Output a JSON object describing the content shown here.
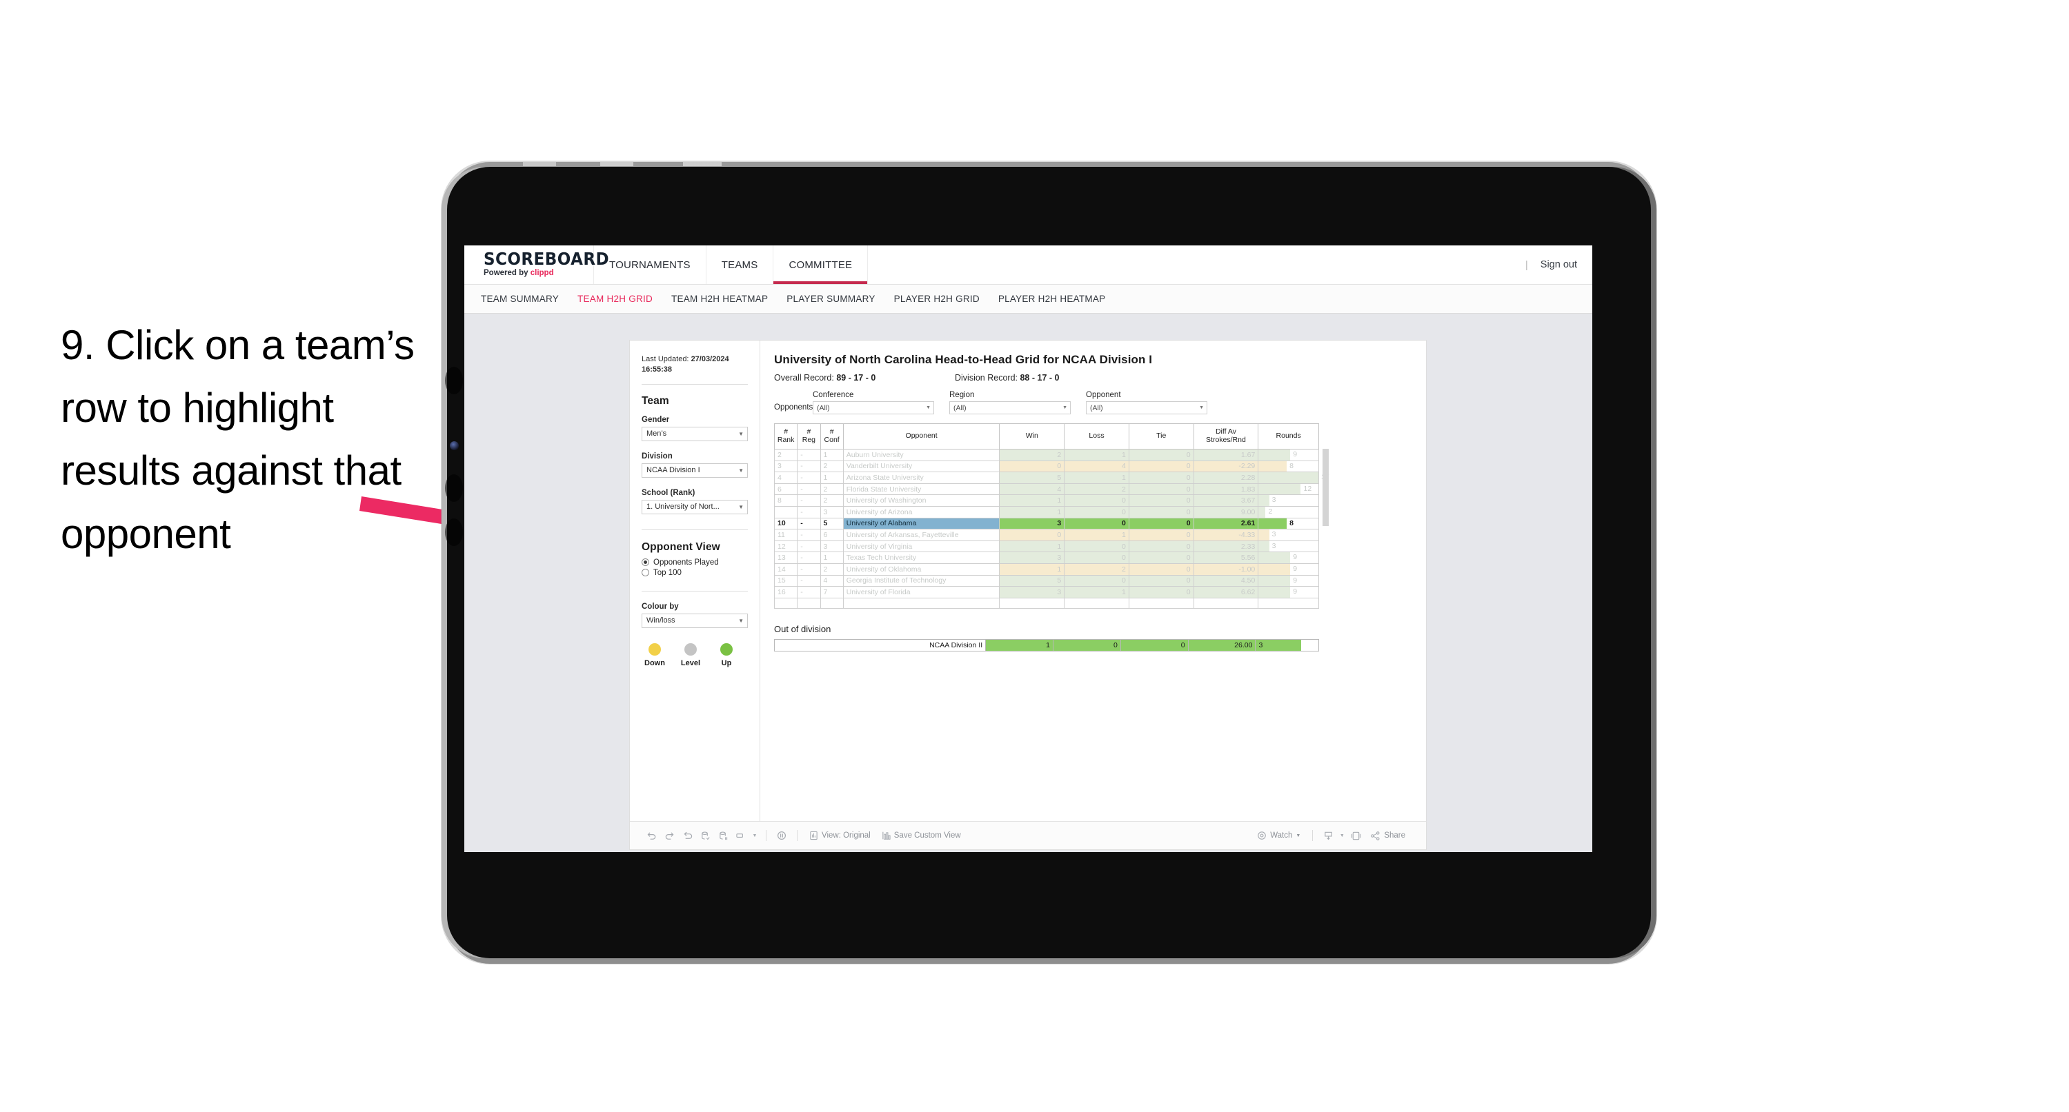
{
  "instruction": {
    "text": "9. Click on a team’s row to highlight results against that opponent"
  },
  "colors": {
    "accent_pink": "#e8295b",
    "arrow_pink": "#ec2a63",
    "highlight_row_name": "#82b2d0",
    "highlight_row_green": "#8bce63",
    "win_tint": "#e3ecdd",
    "loss_tint": "#f7ebcf",
    "legend_down": "#f2d048",
    "legend_level": "#c4c4c4",
    "legend_up": "#7ac143"
  },
  "topbar": {
    "brand_title": "SCOREBOARD",
    "brand_sub_prefix": "Powered by ",
    "brand_sub_accent": "clippd",
    "nav": [
      {
        "label": "TOURNAMENTS",
        "active": false
      },
      {
        "label": "TEAMS",
        "active": false
      },
      {
        "label": "COMMITTEE",
        "active": true
      }
    ],
    "divider": "|",
    "signout": "Sign out"
  },
  "subnav": {
    "items": [
      {
        "label": "TEAM SUMMARY",
        "active": false
      },
      {
        "label": "TEAM H2H GRID",
        "active": true
      },
      {
        "label": "TEAM H2H HEATMAP",
        "active": false
      },
      {
        "label": "PLAYER SUMMARY",
        "active": false
      },
      {
        "label": "PLAYER H2H GRID",
        "active": false
      },
      {
        "label": "PLAYER H2H HEATMAP",
        "active": false
      }
    ]
  },
  "sidebar": {
    "last_updated_label": "Last Updated: ",
    "last_updated_value": "27/03/2024 16:55:38",
    "team_heading": "Team",
    "gender_label": "Gender",
    "gender_value": "Men’s",
    "division_label": "Division",
    "division_value": "NCAA Division I",
    "school_label": "School (Rank)",
    "school_value": "1. University of Nort...",
    "opponent_view_heading": "Opponent View",
    "opponent_view_options": [
      {
        "label": "Opponents Played",
        "selected": true
      },
      {
        "label": "Top 100",
        "selected": false
      }
    ],
    "colour_by_label": "Colour by",
    "colour_by_value": "Win/loss",
    "legend": [
      {
        "caption": "Down",
        "color": "#f2d048"
      },
      {
        "caption": "Level",
        "color": "#c4c4c4"
      },
      {
        "caption": "Up",
        "color": "#7ac143"
      }
    ]
  },
  "view": {
    "title": "University of North Carolina Head-to-Head Grid for NCAA Division I",
    "overall_record_label": "Overall Record: ",
    "overall_record_value": "89 - 17 - 0",
    "division_record_label": "Division Record: ",
    "division_record_value": "88 - 17 - 0",
    "opponents_label": "Opponents:",
    "filters": [
      {
        "caption": "Conference",
        "value": "(All)"
      },
      {
        "caption": "Region",
        "value": "(All)"
      },
      {
        "caption": "Opponent",
        "value": "(All)"
      }
    ]
  },
  "grid": {
    "headers": [
      "# Rank",
      "# Reg",
      "# Conf",
      "Opponent",
      "Win",
      "Loss",
      "Tie",
      "Diff Av Strokes/Rnd",
      "Rounds"
    ],
    "headers_split": [
      {
        "l1": "#",
        "l2": "Rank"
      },
      {
        "l1": "#",
        "l2": "Reg"
      },
      {
        "l1": "#",
        "l2": "Conf"
      },
      {
        "l1": "",
        "l2": "Opponent"
      },
      {
        "l1": "Win",
        "l2": ""
      },
      {
        "l1": "Loss",
        "l2": ""
      },
      {
        "l1": "Tie",
        "l2": ""
      },
      {
        "l1": "Diff Av",
        "l2": "Strokes/Rnd"
      },
      {
        "l1": "Rounds",
        "l2": ""
      }
    ],
    "rounds_max": 17,
    "rows": [
      {
        "rank": "2",
        "reg": "-",
        "conf": "1",
        "opponent": "Auburn University",
        "win": "2",
        "loss": "1",
        "tie": "0",
        "diff": "1.67",
        "rounds": "9",
        "state": "win",
        "highlighted": false
      },
      {
        "rank": "3",
        "reg": "-",
        "conf": "2",
        "opponent": "Vanderbilt University",
        "win": "0",
        "loss": "4",
        "tie": "0",
        "diff": "-2.29",
        "rounds": "8",
        "state": "loss",
        "highlighted": false
      },
      {
        "rank": "4",
        "reg": "-",
        "conf": "1",
        "opponent": "Arizona State University",
        "win": "5",
        "loss": "1",
        "tie": "0",
        "diff": "2.28",
        "rounds": "17",
        "state": "win",
        "highlighted": false
      },
      {
        "rank": "6",
        "reg": "-",
        "conf": "2",
        "opponent": "Florida State University",
        "win": "4",
        "loss": "2",
        "tie": "0",
        "diff": "1.83",
        "rounds": "12",
        "state": "win",
        "highlighted": false
      },
      {
        "rank": "8",
        "reg": "-",
        "conf": "2",
        "opponent": "University of Washington",
        "win": "1",
        "loss": "0",
        "tie": "0",
        "diff": "3.67",
        "rounds": "3",
        "state": "win",
        "highlighted": false
      },
      {
        "rank": "",
        "reg": "-",
        "conf": "3",
        "opponent": "University of Arizona",
        "win": "1",
        "loss": "0",
        "tie": "0",
        "diff": "9.00",
        "rounds": "2",
        "state": "win",
        "highlighted": false
      },
      {
        "rank": "10",
        "reg": "-",
        "conf": "5",
        "opponent": "University of Alabama",
        "win": "3",
        "loss": "0",
        "tie": "0",
        "diff": "2.61",
        "rounds": "8",
        "state": "win",
        "highlighted": true
      },
      {
        "rank": "11",
        "reg": "-",
        "conf": "6",
        "opponent": "University of Arkansas, Fayetteville",
        "win": "0",
        "loss": "1",
        "tie": "0",
        "diff": "-4.33",
        "rounds": "3",
        "state": "loss",
        "highlighted": false
      },
      {
        "rank": "12",
        "reg": "-",
        "conf": "3",
        "opponent": "University of Virginia",
        "win": "1",
        "loss": "0",
        "tie": "0",
        "diff": "2.33",
        "rounds": "3",
        "state": "win",
        "highlighted": false
      },
      {
        "rank": "13",
        "reg": "-",
        "conf": "1",
        "opponent": "Texas Tech University",
        "win": "3",
        "loss": "0",
        "tie": "0",
        "diff": "5.56",
        "rounds": "9",
        "state": "win",
        "highlighted": false
      },
      {
        "rank": "14",
        "reg": "-",
        "conf": "2",
        "opponent": "University of Oklahoma",
        "win": "1",
        "loss": "2",
        "tie": "0",
        "diff": "-1.00",
        "rounds": "9",
        "state": "loss",
        "highlighted": false
      },
      {
        "rank": "15",
        "reg": "-",
        "conf": "4",
        "opponent": "Georgia Institute of Technology",
        "win": "5",
        "loss": "0",
        "tie": "0",
        "diff": "4.50",
        "rounds": "9",
        "state": "win",
        "highlighted": false
      },
      {
        "rank": "16",
        "reg": "-",
        "conf": "7",
        "opponent": "University of Florida",
        "win": "3",
        "loss": "1",
        "tie": "0",
        "diff": "6.62",
        "rounds": "9",
        "state": "win",
        "highlighted": false
      }
    ]
  },
  "out_of_division": {
    "title": "Out of division",
    "row": {
      "name": "NCAA Division II",
      "win": "1",
      "loss": "0",
      "tie": "0",
      "diff": "26.00",
      "rounds": "3"
    }
  },
  "toolbar": {
    "view_label": "View: Original",
    "save_label": "Save Custom View",
    "watch_label": "Watch",
    "share_label": "Share"
  }
}
